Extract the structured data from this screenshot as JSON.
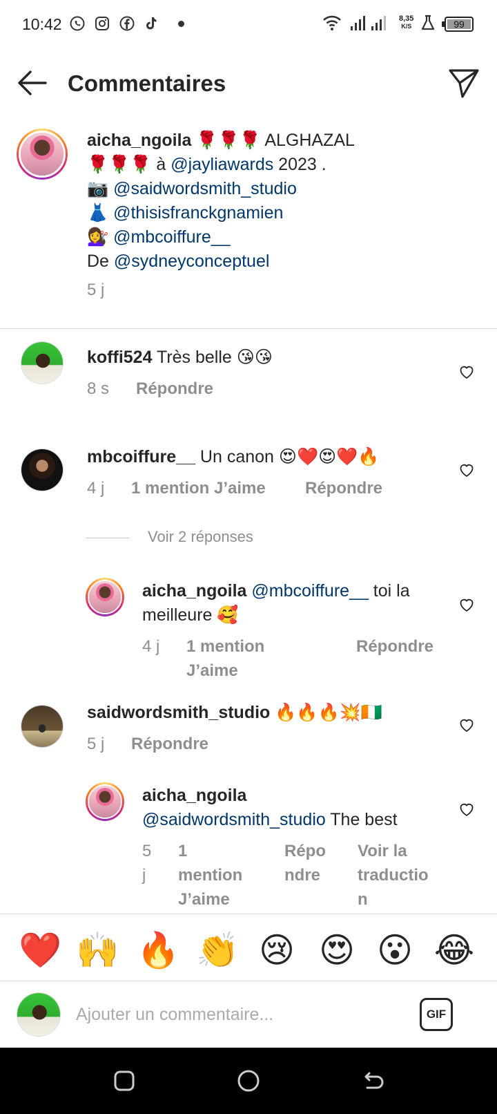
{
  "status_bar": {
    "time": "10:42",
    "speed_value": "8,35",
    "speed_unit": "K/S",
    "battery": "99"
  },
  "header": {
    "title": "Commentaires"
  },
  "caption": {
    "username": "aicha_ngoila",
    "line1_text": " 🌹🌹🌹 ALGHAZAL",
    "line2_prefix": "🌹🌹🌹 à ",
    "line2_mention": "@jayliawards",
    "line2_suffix": " 2023 .",
    "line3_icon": "📷 ",
    "line3_mention": "@saidwordsmith_studio",
    "line4_icon": "👗 ",
    "line4_mention": "@thisisfranckgnamien",
    "line5_icon": "💇‍♀️ ",
    "line5_mention": "@mbcoiffure__",
    "line6_prefix": "De ",
    "line6_mention": "@sydneyconceptuel",
    "time": "5 j"
  },
  "comments": [
    {
      "username": "koffi524",
      "text": " Très belle 😘😘",
      "time": "8 s",
      "reply_label": "Répondre"
    },
    {
      "username": "mbcoiffure__",
      "text": " Un canon 😍❤️😍❤️🔥",
      "time": "4 j",
      "likes": "1 mention J’aime",
      "reply_label": "Répondre"
    }
  ],
  "view_replies": "Voir 2 réponses",
  "replies": [
    {
      "username": "aicha_ngoila",
      "mention": "@mbcoiffure__",
      "text_line1": " toi la",
      "text_line2": "meilleure 🥰",
      "time": "4 j",
      "likes_line1": "1 mention",
      "likes_line2": "J’aime",
      "reply_label": "Répondre"
    }
  ],
  "comment3": {
    "username": "saidwordsmith_studio",
    "text": " 🔥🔥🔥💥🇨🇮",
    "time": "5 j",
    "reply_label": "Répondre"
  },
  "reply2": {
    "username": "aicha_ngoila",
    "mention": "@saidwordsmith_studio",
    "text": " The best",
    "time_line1": "5",
    "time_line2": "j",
    "likes_line1": "1",
    "likes_line2": "mention",
    "likes_line3": "J’aime",
    "reply_line1": "Répo",
    "reply_line2": "ndre",
    "translate_line1": "Voir la",
    "translate_line2": "traductio",
    "translate_line3": "n"
  },
  "emoji_bar": [
    "❤️",
    "🙌",
    "🔥",
    "👏",
    "😢",
    "😍",
    "😮",
    "😂"
  ],
  "input": {
    "placeholder": "Ajouter un commentaire...",
    "gif_label": "GIF"
  }
}
